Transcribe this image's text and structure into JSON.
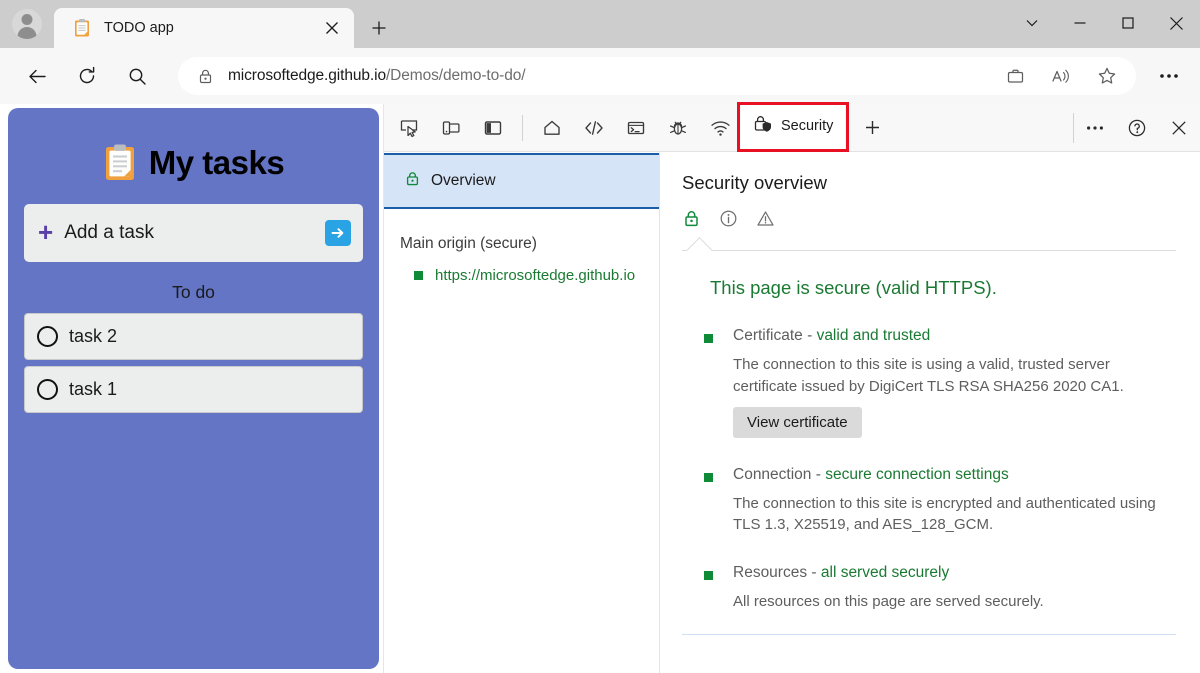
{
  "browser": {
    "avatar": "profile-avatar",
    "tab": {
      "favicon": "clipboard-icon",
      "title": "TODO app",
      "close_label": "✕"
    },
    "new_tab_label": "+",
    "window_controls": {
      "more": "⌄",
      "minimize": "─",
      "maximize": "□",
      "close": "✕"
    },
    "nav": {
      "back": "back-arrow",
      "refresh": "refresh-arrow",
      "search": "search-icon"
    },
    "omnibox": {
      "lock": "lock-icon",
      "url_bold": "microsoftedge.github.io",
      "url_rest": "/Demos/demo-to-do/",
      "actions": [
        "collections-icon",
        "read-aloud-icon",
        "favorites-star-icon"
      ]
    },
    "settings_label": "⋯"
  },
  "todo_app": {
    "title": "My tasks",
    "title_icon": "clipboard-icon",
    "add_task": {
      "plus": "+",
      "placeholder": "Add a task",
      "submit": "submit-arrow-icon"
    },
    "section_label": "To do",
    "tasks": [
      {
        "label": "task 2",
        "done": false
      },
      {
        "label": "task 1",
        "done": false
      }
    ],
    "colors": {
      "panel": "#6375c4",
      "card": "#eceded",
      "submit": "#2aa3e4",
      "plus": "#5b3fa8"
    }
  },
  "devtools": {
    "toolbar_icons": [
      "inspect-element-icon",
      "device-emulation-icon",
      "dock-side-icon"
    ],
    "panel_icons": [
      "welcome-home-icon",
      "elements-code-icon",
      "console-terminal-icon",
      "sources-bug-icon",
      "network-wifi-icon"
    ],
    "active_tab": {
      "label": "Security",
      "icon": "security-lock-shield-icon"
    },
    "add_tab_label": "+",
    "right_icons": [
      "more-tools-ellipsis-icon",
      "help-question-icon",
      "close-devtools-icon"
    ],
    "annotation_color": "#e81123",
    "active_tab_underline_color": "#0b78d0",
    "sidebar": {
      "selected_item": {
        "label": "Overview",
        "icon": "lock-icon"
      },
      "origin_heading": "Main origin (secure)",
      "origins": [
        {
          "url": "https://microsoftedge.github.io",
          "state": "secure"
        }
      ]
    },
    "content": {
      "title": "Security overview",
      "status_icons": [
        "secure-lock-icon",
        "info-icon",
        "warning-triangle-icon"
      ],
      "summary": "This page is secure (valid HTTPS).",
      "sections": [
        {
          "name": "Certificate",
          "separator": " - ",
          "status": "valid and trusted",
          "description": "The connection to this site is using a valid, trusted server certificate issued by DigiCert TLS RSA SHA256 2020 CA1.",
          "button": "View certificate"
        },
        {
          "name": "Connection",
          "separator": " - ",
          "status": "secure connection settings",
          "description": "The connection to this site is encrypted and authenticated using TLS 1.3, X25519, and AES_128_GCM.",
          "button": null
        },
        {
          "name": "Resources",
          "separator": " - ",
          "status": "all served securely",
          "description": "All resources on this page are served securely.",
          "button": null
        }
      ]
    }
  }
}
